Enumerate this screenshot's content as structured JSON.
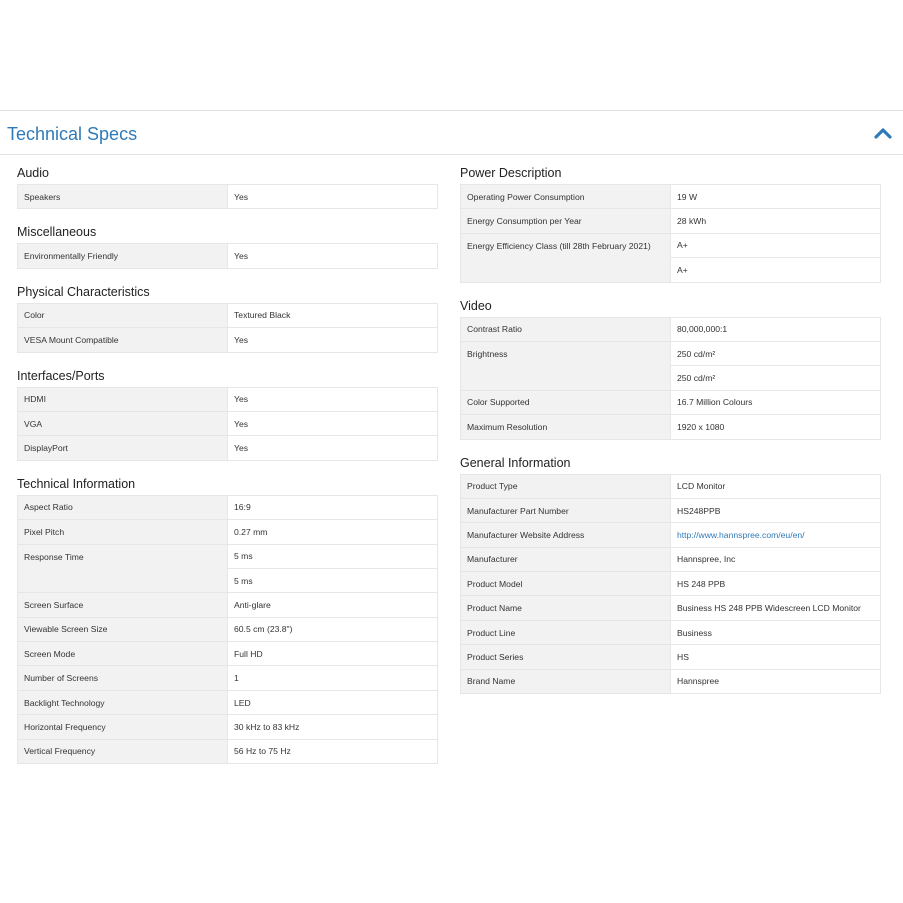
{
  "header": {
    "title": "Technical Specs",
    "collapse_icon": "chevron-up-icon",
    "accent": "#2f7ab8"
  },
  "left": [
    {
      "title": "Audio",
      "rows": [
        {
          "k": "Speakers",
          "v": [
            "Yes"
          ]
        }
      ]
    },
    {
      "title": "Miscellaneous",
      "rows": [
        {
          "k": "Environmentally Friendly",
          "v": [
            "Yes"
          ]
        }
      ]
    },
    {
      "title": "Physical Characteristics",
      "rows": [
        {
          "k": "Color",
          "v": [
            "Textured Black"
          ]
        },
        {
          "k": "VESA Mount Compatible",
          "v": [
            "Yes"
          ]
        }
      ]
    },
    {
      "title": "Interfaces/Ports",
      "rows": [
        {
          "k": "HDMI",
          "v": [
            "Yes"
          ]
        },
        {
          "k": "VGA",
          "v": [
            "Yes"
          ]
        },
        {
          "k": "DisplayPort",
          "v": [
            "Yes"
          ]
        }
      ]
    },
    {
      "title": "Technical Information",
      "rows": [
        {
          "k": "Aspect Ratio",
          "v": [
            "16:9"
          ]
        },
        {
          "k": "Pixel Pitch",
          "v": [
            "0.27 mm"
          ]
        },
        {
          "k": "Response Time",
          "v": [
            "5 ms",
            "5 ms"
          ]
        },
        {
          "k": "Screen Surface",
          "v": [
            "Anti-glare"
          ]
        },
        {
          "k": "Viewable Screen Size",
          "v": [
            "60.5 cm (23.8\")"
          ]
        },
        {
          "k": "Screen Mode",
          "v": [
            "Full HD"
          ]
        },
        {
          "k": "Number of Screens",
          "v": [
            "1"
          ]
        },
        {
          "k": "Backlight Technology",
          "v": [
            "LED"
          ]
        },
        {
          "k": "Horizontal Frequency",
          "v": [
            "30 kHz to 83 kHz"
          ]
        },
        {
          "k": "Vertical Frequency",
          "v": [
            "56 Hz to 75 Hz"
          ]
        }
      ]
    }
  ],
  "right": [
    {
      "title": "Power Description",
      "rows": [
        {
          "k": "Operating Power Consumption",
          "v": [
            "19 W"
          ]
        },
        {
          "k": "Energy Consumption per Year",
          "v": [
            "28 kWh"
          ]
        },
        {
          "k": "Energy Efficiency Class (till 28th February 2021)",
          "v": [
            "A+",
            "A+"
          ]
        }
      ]
    },
    {
      "title": "Video",
      "rows": [
        {
          "k": "Contrast Ratio",
          "v": [
            "80,000,000:1"
          ]
        },
        {
          "k": "Brightness",
          "v": [
            "250 cd/m²",
            "250 cd/m²"
          ]
        },
        {
          "k": "Color Supported",
          "v": [
            "16.7 Million Colours"
          ]
        },
        {
          "k": "Maximum Resolution",
          "v": [
            "1920 x 1080"
          ]
        }
      ]
    },
    {
      "title": "General Information",
      "rows": [
        {
          "k": "Product Type",
          "v": [
            "LCD Monitor"
          ]
        },
        {
          "k": "Manufacturer Part Number",
          "v": [
            "HS248PPB"
          ]
        },
        {
          "k": "Manufacturer Website Address",
          "v": [
            "http://www.hannspree.com/eu/en/"
          ],
          "link": true
        },
        {
          "k": "Manufacturer",
          "v": [
            "Hannspree, Inc"
          ]
        },
        {
          "k": "Product Model",
          "v": [
            "HS 248 PPB"
          ]
        },
        {
          "k": "Product Name",
          "v": [
            "Business HS 248 PPB Widescreen LCD Monitor"
          ]
        },
        {
          "k": "Product Line",
          "v": [
            "Business"
          ]
        },
        {
          "k": "Product Series",
          "v": [
            "HS"
          ]
        },
        {
          "k": "Brand Name",
          "v": [
            "Hannspree"
          ]
        }
      ]
    }
  ]
}
